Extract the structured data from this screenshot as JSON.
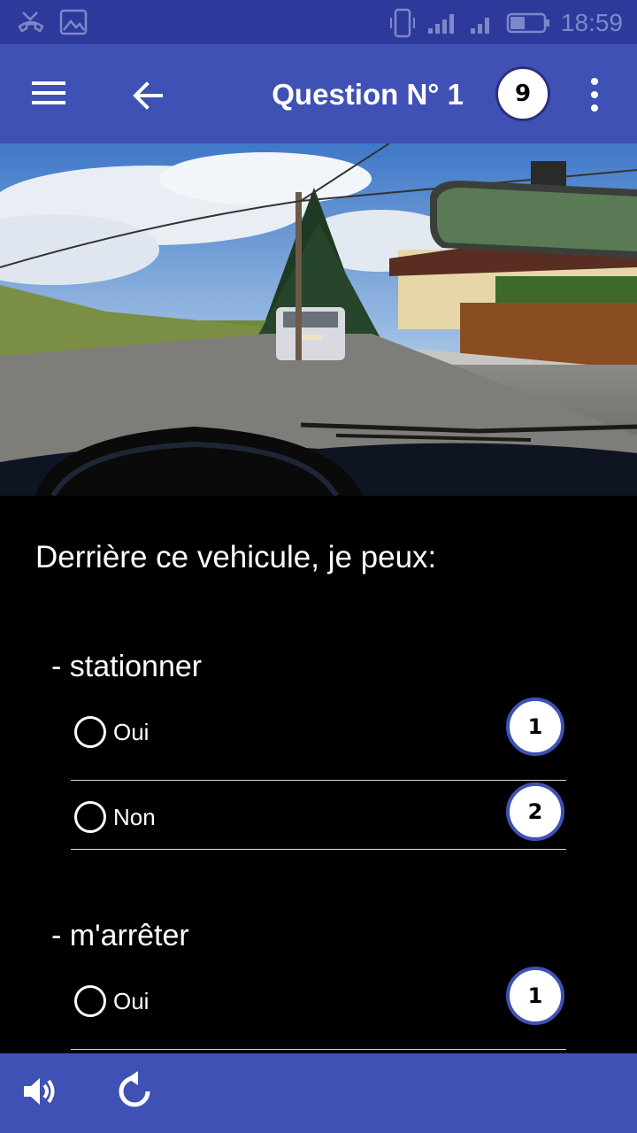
{
  "status_bar": {
    "time": "18:59",
    "icons": [
      "missed-call-icon",
      "image-icon",
      "phone-vibrate-icon",
      "signal-icon",
      "signal-icon",
      "battery-icon"
    ]
  },
  "app_bar": {
    "title": "Question N° 1",
    "count_badge": "9",
    "icons": [
      "menu-icon",
      "back-arrow-icon",
      "overflow-menu-icon"
    ]
  },
  "question": {
    "text": "Derrière ce vehicule, je peux:"
  },
  "sections": [
    {
      "label": "- stationner",
      "options": [
        {
          "label": "Oui",
          "badge": "1"
        },
        {
          "label": "Non",
          "badge": "2"
        }
      ]
    },
    {
      "label": "- m'arrêter",
      "options": [
        {
          "label": "Oui",
          "badge": "1"
        }
      ]
    }
  ],
  "bottom_bar": {
    "icons": [
      "volume-icon",
      "replay-icon"
    ]
  },
  "colors": {
    "primary": "#3f51b5",
    "status_bar": "#2d3a9c",
    "background": "#000000"
  }
}
